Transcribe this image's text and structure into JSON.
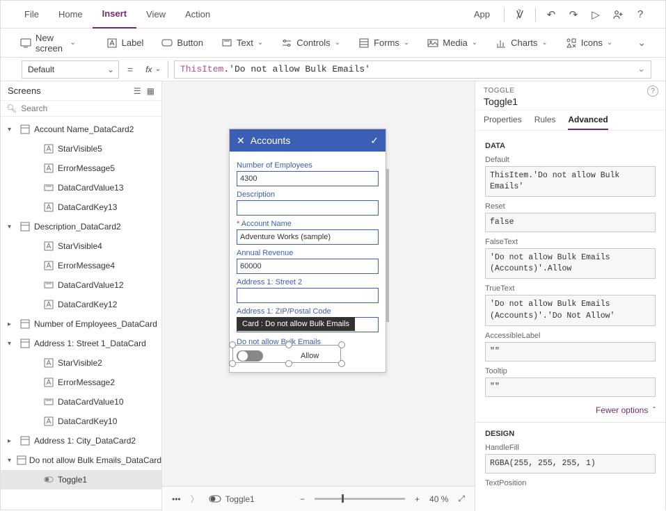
{
  "menu": {
    "file": "File",
    "home": "Home",
    "insert": "Insert",
    "view": "View",
    "action": "Action",
    "app": "App"
  },
  "ribbon": {
    "newscreen": "New screen",
    "label": "Label",
    "button": "Button",
    "text": "Text",
    "controls": "Controls",
    "forms": "Forms",
    "media": "Media",
    "charts": "Charts",
    "icons": "Icons"
  },
  "formula": {
    "prop": "Default",
    "thisitem": "ThisItem",
    "rest": ".'Do not allow Bulk Emails'"
  },
  "tree": {
    "title": "Screens",
    "searchPlaceholder": "Search",
    "nodes": [
      {
        "d": 0,
        "c": "▾",
        "ic": "card",
        "t": "Account Name_DataCard2"
      },
      {
        "d": 1,
        "ic": "ctrl",
        "t": "StarVisible5"
      },
      {
        "d": 1,
        "ic": "ctrl",
        "t": "ErrorMessage5"
      },
      {
        "d": 1,
        "ic": "val",
        "t": "DataCardValue13"
      },
      {
        "d": 1,
        "ic": "ctrl",
        "t": "DataCardKey13"
      },
      {
        "d": 0,
        "c": "▾",
        "ic": "card",
        "t": "Description_DataCard2"
      },
      {
        "d": 1,
        "ic": "ctrl",
        "t": "StarVisible4"
      },
      {
        "d": 1,
        "ic": "ctrl",
        "t": "ErrorMessage4"
      },
      {
        "d": 1,
        "ic": "val",
        "t": "DataCardValue12"
      },
      {
        "d": 1,
        "ic": "ctrl",
        "t": "DataCardKey12"
      },
      {
        "d": 0,
        "c": "▸",
        "ic": "card",
        "t": "Number of Employees_DataCard"
      },
      {
        "d": 0,
        "c": "▾",
        "ic": "card",
        "t": "Address 1: Street 1_DataCard"
      },
      {
        "d": 1,
        "ic": "ctrl",
        "t": "StarVisible2"
      },
      {
        "d": 1,
        "ic": "ctrl",
        "t": "ErrorMessage2"
      },
      {
        "d": 1,
        "ic": "val",
        "t": "DataCardValue10"
      },
      {
        "d": 1,
        "ic": "ctrl",
        "t": "DataCardKey10"
      },
      {
        "d": 0,
        "c": "▸",
        "ic": "card",
        "t": "Address 1: City_DataCard2"
      },
      {
        "d": 0,
        "c": "▾",
        "ic": "card",
        "t": "Do not allow Bulk Emails_DataCard"
      },
      {
        "d": 1,
        "ic": "tog",
        "t": "Toggle1",
        "sel": true
      }
    ]
  },
  "phone": {
    "title": "Accounts",
    "fields": [
      {
        "label": "Number of Employees",
        "value": "4300"
      },
      {
        "label": "Description",
        "value": ""
      },
      {
        "label": "Account Name",
        "value": "Adventure Works (sample)",
        "req": true
      },
      {
        "label": "Annual Revenue",
        "value": "60000"
      },
      {
        "label": "Address 1: Street 2",
        "value": ""
      },
      {
        "label": "Address 1: ZIP/Postal Code",
        "value": ""
      }
    ],
    "tooltip": "Card : Do not allow Bulk Emails",
    "toggleLabel": "Do not allow Bulk Emails",
    "toggleText": "Allow"
  },
  "canvasBar": {
    "crumb": "Toggle1",
    "zoom": "40 %"
  },
  "panel": {
    "type": "TOGGLE",
    "name": "Toggle1",
    "tabs": {
      "p": "Properties",
      "r": "Rules",
      "a": "Advanced"
    },
    "data": {
      "section": "DATA",
      "Default": "ThisItem.'Do not allow Bulk Emails'",
      "Reset": "false",
      "FalseText": "'Do not allow Bulk Emails (Accounts)'.Allow",
      "TrueText": "'Do not allow Bulk Emails (Accounts)'.'Do Not Allow'",
      "AccessibleLabel": "\"\"",
      "Tooltip": "\"\"",
      "fewer": "Fewer options"
    },
    "design": {
      "section": "DESIGN",
      "HandleFill": "RGBA(255, 255, 255, 1)",
      "TextPosition": "TextPosition"
    }
  }
}
